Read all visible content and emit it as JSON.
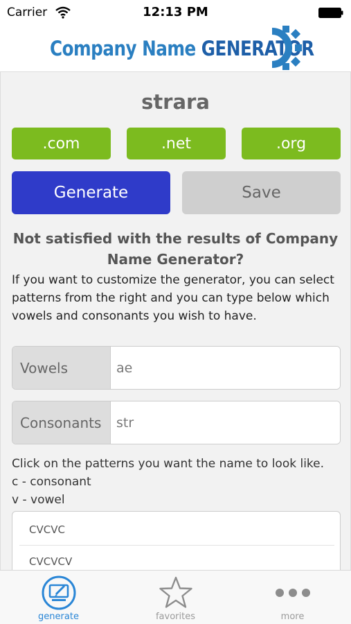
{
  "status_bar": {
    "carrier": "Carrier",
    "time": "12:13 PM"
  },
  "header": {
    "logo_main": "Company Name ",
    "logo_accent": "GENERATOR"
  },
  "result": {
    "name": "strara"
  },
  "domains": {
    "com": ".com",
    "net": ".net",
    "org": ".org"
  },
  "actions": {
    "generate": "Generate",
    "save": "Save"
  },
  "help": {
    "question": "Not satisfied with the results of Company Name Generator?",
    "explanation": "If you want to customize the generator, you can select patterns from the right and you can type below which vowels and consonants you wish to have."
  },
  "fields": {
    "vowels": {
      "label": "Vowels",
      "value": "ae"
    },
    "consonants": {
      "label": "Consonants",
      "value": "str"
    }
  },
  "patterns": {
    "instructions": "Click on the patterns you want the name to look like.",
    "legend_c": "c - consonant",
    "legend_v": "v - vowel",
    "items": [
      "CVCVC",
      "CVCVCV"
    ]
  },
  "tabs": [
    {
      "label": "generate",
      "icon": "monitor-edit-icon",
      "active": true
    },
    {
      "label": "favorites",
      "icon": "star-icon",
      "active": false
    },
    {
      "label": "more",
      "icon": "more-dots-icon",
      "active": false
    }
  ],
  "colors": {
    "tld_green": "#7cbb1f",
    "generate_blue": "#2f3bc9",
    "active_tab": "#2a86d6",
    "logo_blue": "#2a7fc1"
  }
}
